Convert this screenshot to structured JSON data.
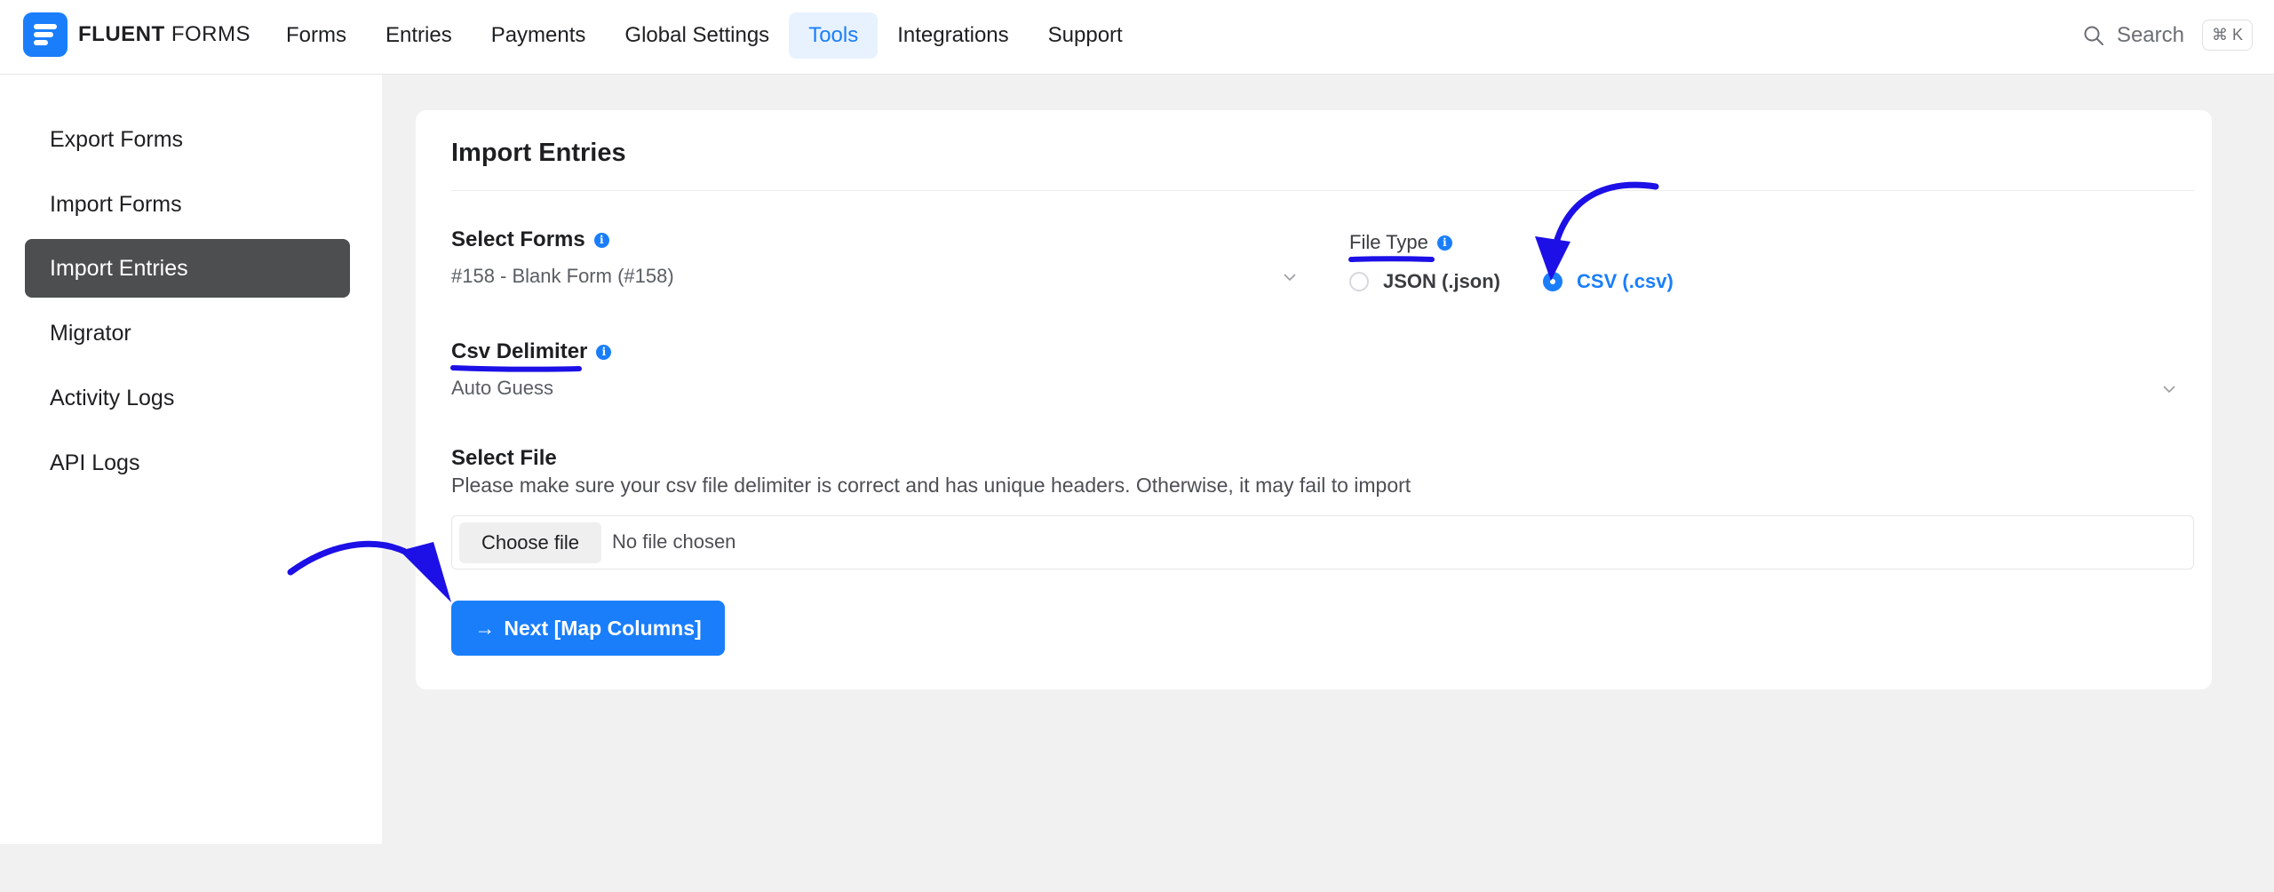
{
  "brand": {
    "name_bold": "FLUENT",
    "name_light": "FORMS"
  },
  "nav": {
    "items": [
      {
        "label": "Forms"
      },
      {
        "label": "Entries"
      },
      {
        "label": "Payments"
      },
      {
        "label": "Global Settings"
      },
      {
        "label": "Tools",
        "active": true
      },
      {
        "label": "Integrations"
      },
      {
        "label": "Support"
      }
    ]
  },
  "search": {
    "label": "Search",
    "shortcut": "⌘ K"
  },
  "sidebar": {
    "items": [
      {
        "label": "Export Forms"
      },
      {
        "label": "Import Forms"
      },
      {
        "label": "Import Entries",
        "active": true
      },
      {
        "label": "Migrator"
      },
      {
        "label": "Activity Logs"
      },
      {
        "label": "API Logs"
      }
    ]
  },
  "card": {
    "title": "Import Entries",
    "select_forms": {
      "label": "Select Forms",
      "value": "#158 - Blank Form (#158)"
    },
    "file_type": {
      "label": "File Type",
      "options": [
        {
          "label": "JSON (.json)",
          "checked": false
        },
        {
          "label": "CSV (.csv)",
          "checked": true
        }
      ]
    },
    "csv_delimiter": {
      "label": "Csv Delimiter",
      "value": "Auto Guess"
    },
    "select_file": {
      "label": "Select File",
      "help": "Please make sure your csv file delimiter is correct and has unique headers. Otherwise, it may fail to import",
      "button": "Choose file",
      "status": "No file chosen"
    },
    "next_button": {
      "arrow": "→",
      "label": "Next [Map Columns]"
    }
  },
  "colors": {
    "accent": "#1a7efb",
    "annotation": "#1c10e6",
    "sidebar_active": "#4d4e50"
  }
}
